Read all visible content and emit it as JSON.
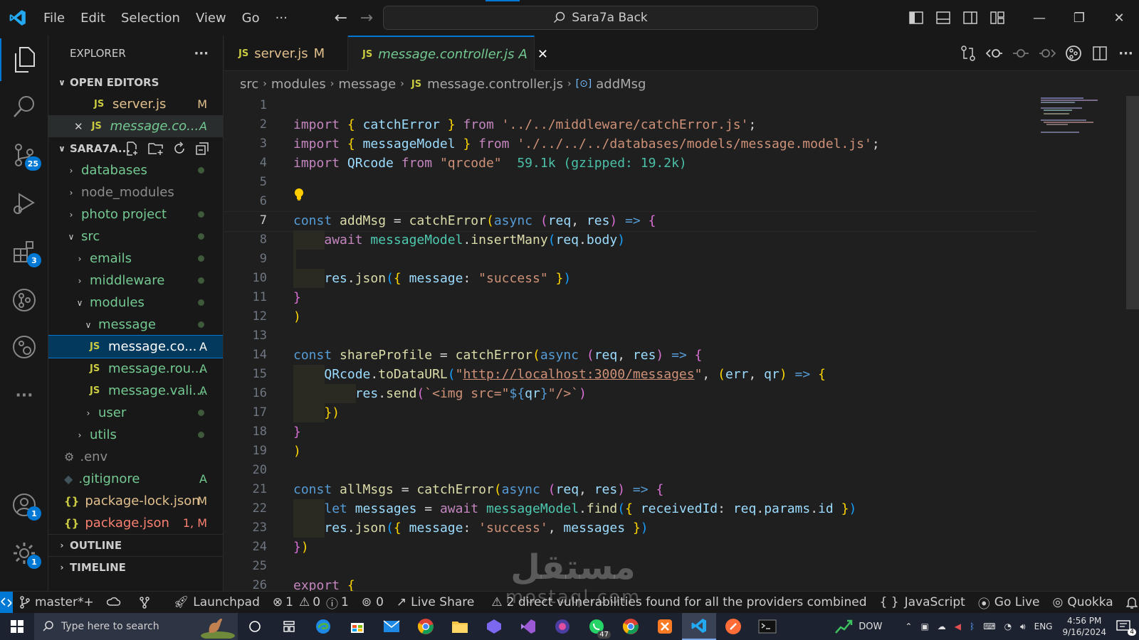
{
  "titlebar": {
    "menu": [
      "File",
      "Edit",
      "Selection",
      "View",
      "Go",
      "···"
    ],
    "search_label": "Sara7a Back"
  },
  "activity_bar": {
    "source_control_badge": "25",
    "extensions_badge": "3",
    "accounts_badge": "1",
    "settings_badge": "1"
  },
  "sidebar": {
    "title": "EXPLORER",
    "more": "···",
    "open_editors_label": "OPEN EDITORS",
    "open_editors": [
      {
        "name": "server.js",
        "status": "M"
      },
      {
        "name": "message.co...",
        "status": "A"
      }
    ],
    "project_label": "SARA7A...",
    "tree": [
      {
        "name": "databases"
      },
      {
        "name": "node_modules"
      },
      {
        "name": "photo project"
      },
      {
        "name": "src"
      },
      {
        "name": "emails"
      },
      {
        "name": "middleware"
      },
      {
        "name": "modules"
      },
      {
        "name": "message"
      },
      {
        "name": "message.co...",
        "status": "A"
      },
      {
        "name": "message.rou...",
        "status": "A"
      },
      {
        "name": "message.vali...",
        "status": "A"
      },
      {
        "name": "user"
      },
      {
        "name": "utils"
      },
      {
        "name": ".env"
      },
      {
        "name": ".gitignore",
        "status": "A"
      },
      {
        "name": "package-lock.json",
        "status": "M"
      },
      {
        "name": "package.json",
        "status": "1, M"
      }
    ],
    "outline_label": "OUTLINE",
    "timeline_label": "TIMELINE"
  },
  "tabs": [
    {
      "name": "server.js",
      "status": "M"
    },
    {
      "name": "message.controller.js",
      "status": "A"
    }
  ],
  "breadcrumb": [
    "src",
    "modules",
    "message",
    "message.controller.js",
    "addMsg"
  ],
  "editor": {
    "line_numbers": [
      "1",
      "2",
      "3",
      "4",
      "5",
      "6",
      "7",
      "8",
      "9",
      "10",
      "11",
      "12",
      "13",
      "14",
      "15",
      "16",
      "17",
      "18",
      "19",
      "20",
      "21",
      "22",
      "23",
      "24",
      "25",
      "26"
    ]
  },
  "statusbar": {
    "branch": "master*+",
    "launchpad": "Launchpad",
    "errors": "1",
    "warnings": "0",
    "infos": "1",
    "ports": "0",
    "live_share": "Live Share",
    "vulnerabilities": "2 direct vulnerabilities found for all the providers combined",
    "language": "JavaScript",
    "go_live": "Go Live",
    "quokka": "Quokka"
  },
  "taskbar": {
    "search_placeholder": "Type here to search",
    "whatsapp_badge": "47",
    "stock_label": "DOW",
    "lang": "ENG",
    "time": "4:56 PM",
    "date": "9/16/2024",
    "notif_badge": "4"
  },
  "watermark": {
    "arabic": "مستقل",
    "latin": "mostaql.com"
  },
  "colors": {
    "accent": "#0078d4",
    "keyword": "#569cd6",
    "string": "#ce9178",
    "function": "#dcdcaa",
    "variable": "#9cdcfe",
    "git_added": "#73c991",
    "git_modified": "#e2c08d"
  }
}
